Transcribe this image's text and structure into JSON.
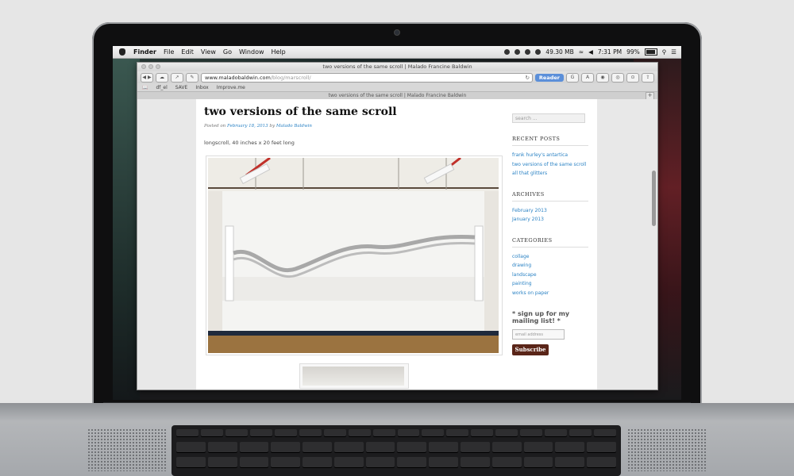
{
  "menubar": {
    "app": "Finder",
    "items": [
      "File",
      "Edit",
      "View",
      "Go",
      "Window",
      "Help"
    ],
    "memory": "49.30 MB",
    "time": "7:31 PM",
    "battery": "99%"
  },
  "browser": {
    "window_title": "two versions of the same scroll | Malado Francine Baldwin",
    "url_domain": "www.maladobaldwin.com",
    "url_path": "/blog/marscroll/",
    "reader_label": "Reader",
    "favorites": [
      "df_el",
      "SAVE",
      "Inbox",
      "Improve.me"
    ],
    "tab_title": "two versions of the same scroll | Malado Francine Baldwin"
  },
  "post": {
    "title": "two versions of the same scroll",
    "posted_on_label": "Posted on",
    "date": "February 18, 2013",
    "by_label": "by",
    "author": "Malado Baldwin",
    "description": "longscroll, 40 inches x 20 feet long"
  },
  "sidebar": {
    "search_placeholder": "search ...",
    "recent_posts_title": "RECENT POSTS",
    "recent_posts": [
      "frank hurley's antartica",
      "two versions of the same scroll",
      "all that glitters"
    ],
    "archives_title": "ARCHIVES",
    "archives": [
      "February 2013",
      "January 2013"
    ],
    "categories_title": "CATEGORIES",
    "categories": [
      "collage",
      "drawing",
      "landscape",
      "painting",
      "works on paper"
    ],
    "mailing_title": "* sign up for my mailing list! *",
    "email_placeholder": "email address",
    "subscribe_label": "Subscribe"
  },
  "colors": {
    "link": "#2a82c4",
    "reader_button": "#5b8fd9",
    "subscribe_button": "#5a2518"
  }
}
